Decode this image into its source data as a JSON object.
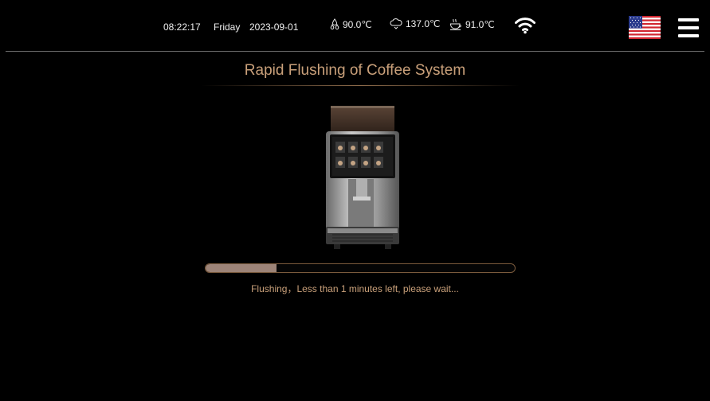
{
  "header": {
    "time": "08:22:17",
    "day": "Friday",
    "date": "2023-09-01",
    "temps": [
      {
        "icon": "water-drops-icon",
        "value": "90.0℃"
      },
      {
        "icon": "steam-cloud-icon",
        "value": "137.0℃"
      },
      {
        "icon": "hot-cup-icon",
        "value": "91.0℃"
      }
    ],
    "wifi_icon": "wifi-icon",
    "flag_icon": "us-flag-icon",
    "menu_icon": "hamburger-menu-icon"
  },
  "main": {
    "title": "Rapid Flushing of Coffee System",
    "progress_fraction": 0.23,
    "message": "Flushing，Less than 1 minutes left, please wait..."
  },
  "colors": {
    "accent": "#c9a07a",
    "progress_fill": "#9d8478",
    "progress_border": "#7a5a3c",
    "background": "#000000"
  }
}
